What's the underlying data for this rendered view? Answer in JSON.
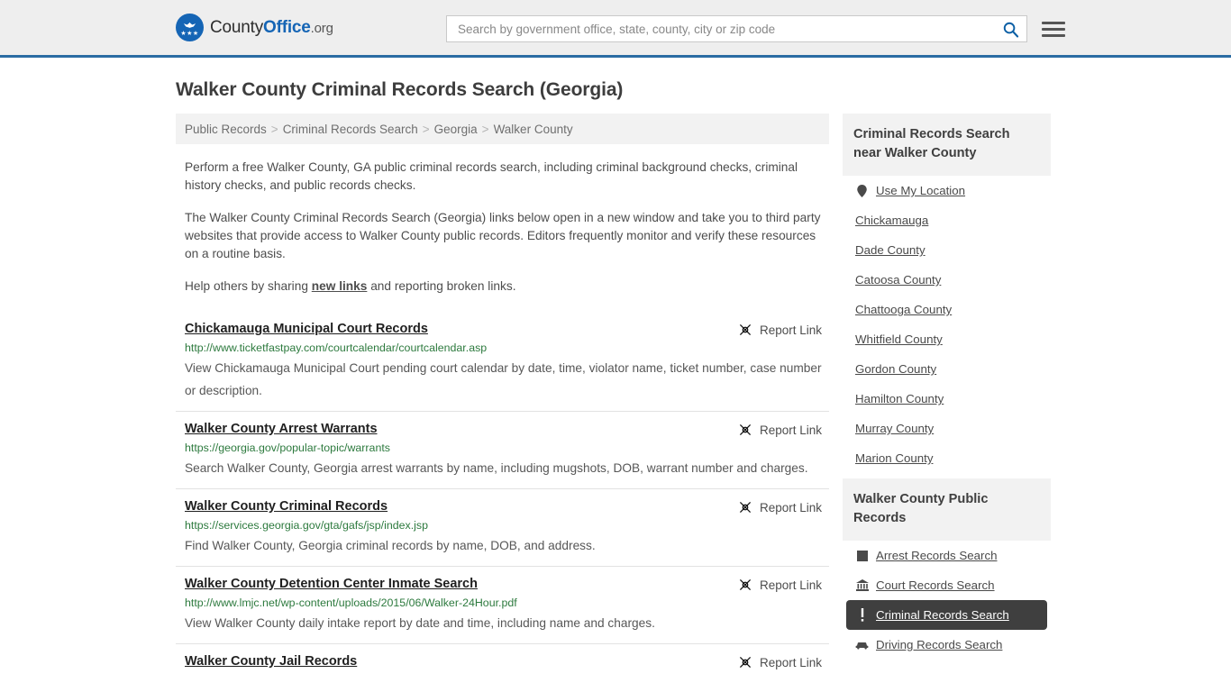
{
  "header": {
    "logo": {
      "name_part1": "County",
      "name_part2": "Office",
      "name_part3": ".org",
      "stars": "★★★"
    },
    "search": {
      "placeholder": "Search by government office, state, county, city or zip code",
      "value": "",
      "icon": "search-icon"
    },
    "menu_icon": "hamburger-menu-icon"
  },
  "page": {
    "title": "Walker County Criminal Records Search (Georgia)"
  },
  "breadcrumb": {
    "items": [
      {
        "label": "Public Records"
      },
      {
        "label": "Criminal Records Search"
      },
      {
        "label": "Georgia"
      },
      {
        "label": "Walker County"
      }
    ],
    "separator": ">"
  },
  "intro": {
    "p1": "Perform a free Walker County, GA public criminal records search, including criminal background checks, criminal history checks, and public records checks.",
    "p2": "The Walker County Criminal Records Search (Georgia) links below open in a new window and take you to third party websites that provide access to Walker County public records. Editors frequently monitor and verify these resources on a routine basis.",
    "p3_before": "Help others by sharing ",
    "p3_link": "new links",
    "p3_after": " and reporting broken links."
  },
  "report_link_label": "Report Link",
  "results": [
    {
      "title": "Chickamauga Municipal Court Records",
      "url": "http://www.ticketfastpay.com/courtcalendar/courtcalendar.asp",
      "description": "View Chickamauga Municipal Court pending court calendar by date, time, violator name, ticket number, case number or description.",
      "report_label": "Report Link"
    },
    {
      "title": "Walker County Arrest Warrants",
      "url": "https://georgia.gov/popular-topic/warrants",
      "description": "Search Walker County, Georgia arrest warrants by name, including mugshots, DOB, warrant number and charges.",
      "report_label": "Report Link"
    },
    {
      "title": "Walker County Criminal Records",
      "url": "https://services.georgia.gov/gta/gafs/jsp/index.jsp",
      "description": "Find Walker County, Georgia criminal records by name, DOB, and address.",
      "report_label": "Report Link"
    },
    {
      "title": "Walker County Detention Center Inmate Search",
      "url": "http://www.lmjc.net/wp-content/uploads/2015/06/Walker-24Hour.pdf",
      "description": "View Walker County daily intake report by date and time, including name and charges.",
      "report_label": "Report Link"
    },
    {
      "title": "Walker County Jail Records",
      "url": "",
      "description": "",
      "report_label": "Report Link"
    }
  ],
  "sidebar": {
    "nearby": {
      "heading": "Criminal Records Search near Walker County",
      "items": [
        {
          "label": "Use My Location",
          "icon": "map-pin-icon",
          "active": false
        },
        {
          "label": "Chickamauga",
          "icon": "",
          "active": false
        },
        {
          "label": "Dade County",
          "icon": "",
          "active": false
        },
        {
          "label": "Catoosa County",
          "icon": "",
          "active": false
        },
        {
          "label": "Chattooga County",
          "icon": "",
          "active": false
        },
        {
          "label": "Whitfield County",
          "icon": "",
          "active": false
        },
        {
          "label": "Gordon County",
          "icon": "",
          "active": false
        },
        {
          "label": "Hamilton County",
          "icon": "",
          "active": false
        },
        {
          "label": "Murray County",
          "icon": "",
          "active": false
        },
        {
          "label": "Marion County",
          "icon": "",
          "active": false
        }
      ]
    },
    "public_records": {
      "heading": "Walker County Public Records",
      "items": [
        {
          "label": "Arrest Records Search",
          "icon": "square-icon",
          "active": false
        },
        {
          "label": "Court Records Search",
          "icon": "courthouse-icon",
          "active": false
        },
        {
          "label": "Criminal Records Search",
          "icon": "exclamation-icon",
          "active": true
        },
        {
          "label": "Driving Records Search",
          "icon": "car-icon",
          "active": false
        }
      ]
    }
  },
  "colors": {
    "brand_blue": "#1565b5",
    "header_border": "#2b6ca3",
    "header_bg": "#eeeeee",
    "url_green": "#2d7a3e",
    "active_bg": "#3f3f3f",
    "panel_bg": "#f2f2f2"
  }
}
